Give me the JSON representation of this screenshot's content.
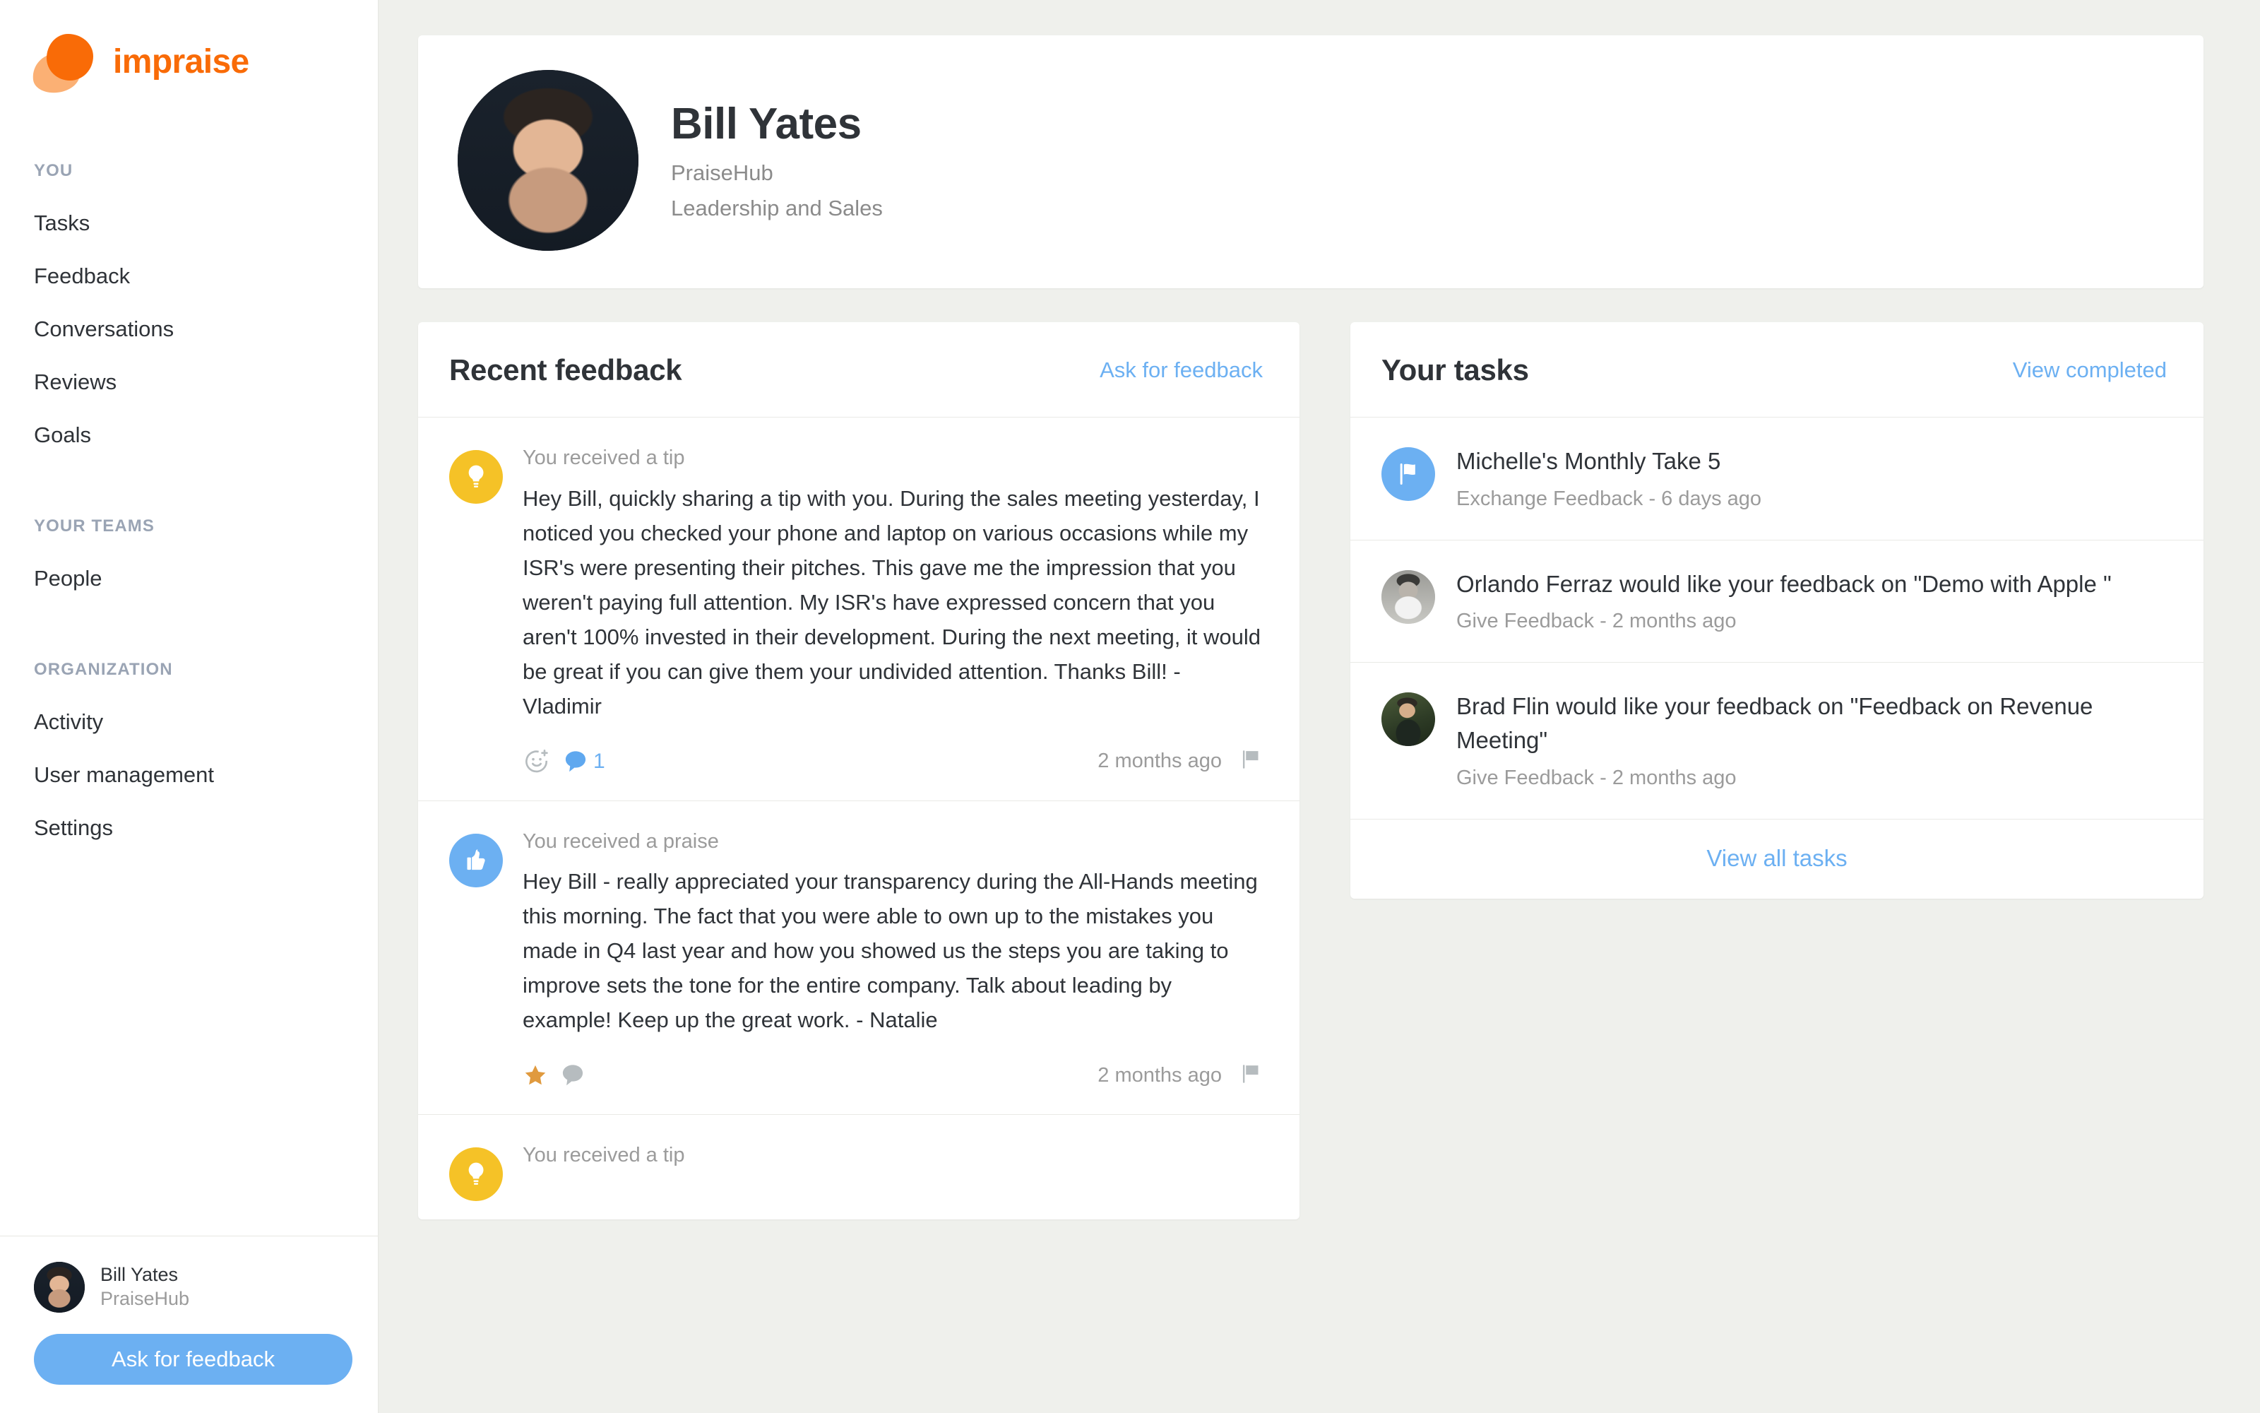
{
  "brand": {
    "name": "impraise",
    "logo_icon": "impraise-blob-logo",
    "accent_orange": "#f96b07",
    "accent_blue": "#6cb0f2",
    "tip_yellow": "#f5c227",
    "star_orange": "#e09a3e"
  },
  "sidebar": {
    "groups": [
      {
        "label": "YOU",
        "items": [
          {
            "label": "Tasks",
            "name": "sidebar-item-tasks"
          },
          {
            "label": "Feedback",
            "name": "sidebar-item-feedback"
          },
          {
            "label": "Conversations",
            "name": "sidebar-item-conversations"
          },
          {
            "label": "Reviews",
            "name": "sidebar-item-reviews"
          },
          {
            "label": "Goals",
            "name": "sidebar-item-goals"
          }
        ]
      },
      {
        "label": "YOUR TEAMS",
        "items": [
          {
            "label": "People",
            "name": "sidebar-item-people"
          }
        ]
      },
      {
        "label": "ORGANIZATION",
        "items": [
          {
            "label": "Activity",
            "name": "sidebar-item-activity"
          },
          {
            "label": "User management",
            "name": "sidebar-item-user-management"
          },
          {
            "label": "Settings",
            "name": "sidebar-item-settings"
          }
        ]
      }
    ],
    "footer": {
      "avatar_icon": "user-avatar-bill-yates",
      "name": "Bill Yates",
      "org": "PraiseHub",
      "ask_button_label": "Ask for feedback"
    }
  },
  "profile": {
    "avatar_icon": "profile-avatar-bill-yates",
    "name": "Bill Yates",
    "org": "PraiseHub",
    "team": "Leadership and Sales"
  },
  "recent_feedback": {
    "title": "Recent feedback",
    "action_label": "Ask for feedback",
    "items": [
      {
        "icon": "lightbulb-icon",
        "kind": "tip",
        "kind_label": "You received a tip",
        "text": "Hey Bill, quickly sharing a tip with you. During the sales meeting yesterday, I noticed you checked your phone and laptop on various occasions while my ISR's were presenting their pitches. This gave me the impression that you weren't paying full attention. My ISR's have expressed concern that you aren't 100% invested in their development. During the next meeting, it would be great if you can give them your undivided attention. Thanks Bill! - Vladimir",
        "reaction_add_icon": "add-reaction-smiley-icon",
        "comment_icon": "comment-bubble-icon",
        "comment_count": "1",
        "time": "2 months ago",
        "flag_icon": "flag-icon"
      },
      {
        "icon": "thumbs-up-icon",
        "kind": "praise",
        "kind_label": "You received a praise",
        "text": "Hey Bill - really appreciated your transparency during the All-Hands meeting this morning. The fact that you were able to own up to the mistakes you made in Q4 last year and how you showed us the steps you are taking to improve sets the tone for the entire company. Talk about leading by example! Keep up the great work. - Natalie",
        "reaction_add_icon": "star-icon",
        "comment_icon": "comment-bubble-icon",
        "comment_count": "",
        "time": "2 months ago",
        "flag_icon": "flag-icon"
      },
      {
        "icon": "lightbulb-icon",
        "kind": "tip",
        "kind_label": "You received a tip",
        "text": "",
        "reaction_add_icon": "",
        "comment_icon": "",
        "comment_count": "",
        "time": "",
        "flag_icon": ""
      }
    ]
  },
  "your_tasks": {
    "title": "Your tasks",
    "action_label": "View completed",
    "items": [
      {
        "icon": "flag-circle-icon",
        "avatar_icon": "",
        "title": "Michelle's Monthly Take 5",
        "subtitle": "Exchange Feedback - 6 days ago"
      },
      {
        "icon": "",
        "avatar_icon": "task-avatar-orlando-ferraz",
        "title": "Orlando Ferraz would like your feedback on \"Demo with Apple \"",
        "subtitle": "Give Feedback - 2 months ago"
      },
      {
        "icon": "",
        "avatar_icon": "task-avatar-brad-flin",
        "title": "Brad Flin would like your feedback on \"Feedback on Revenue Meeting\"",
        "subtitle": "Give Feedback - 2 months ago"
      }
    ],
    "view_all_label": "View all tasks"
  }
}
